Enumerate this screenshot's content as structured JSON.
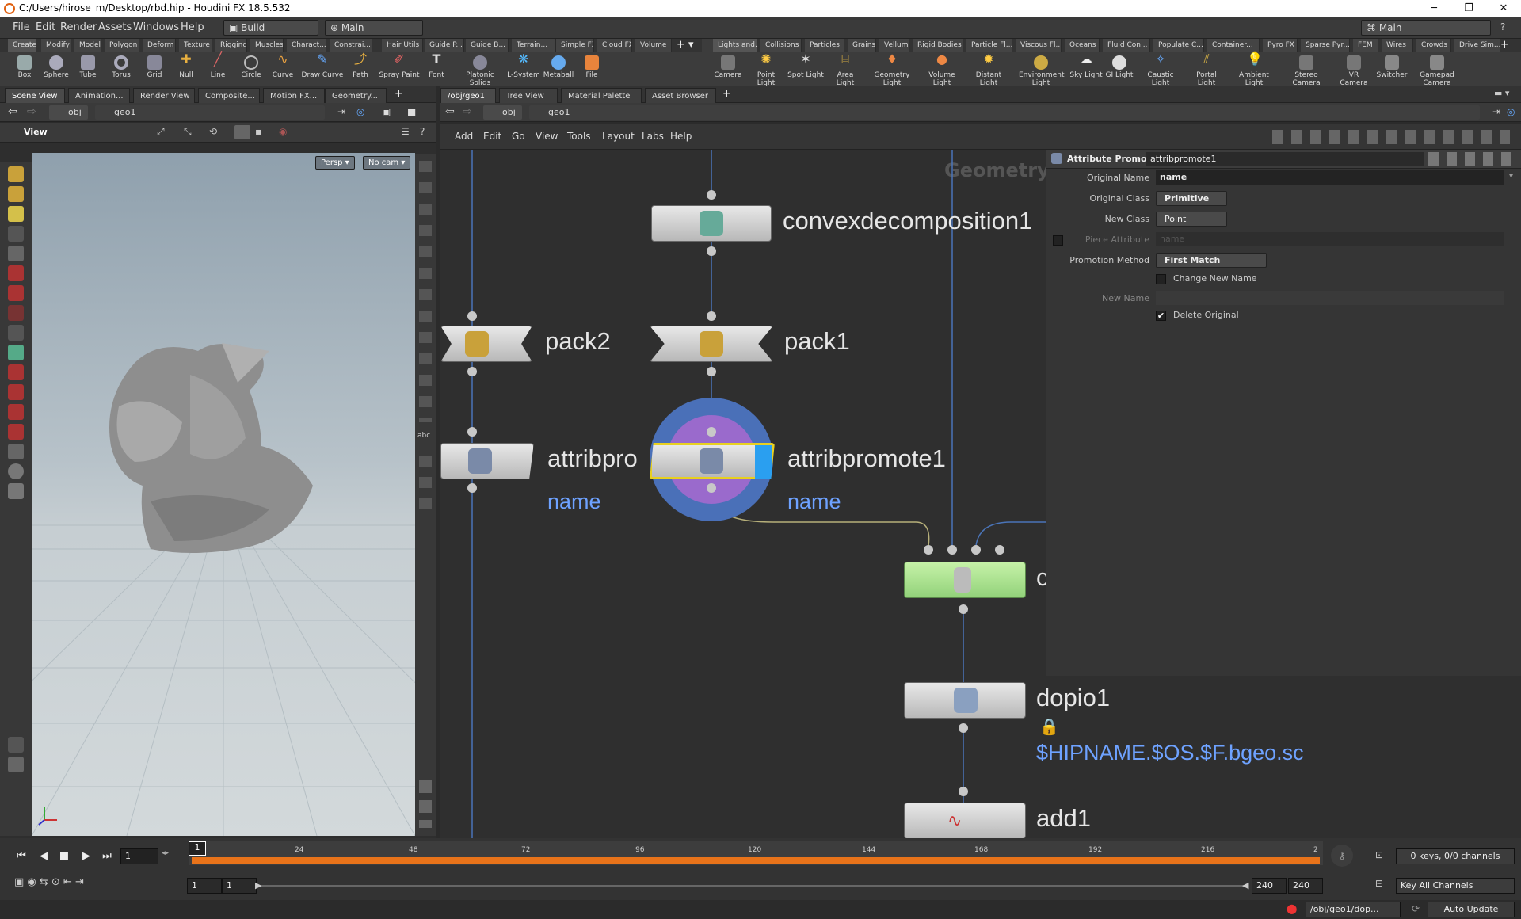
{
  "title_bar": {
    "text": "C:/Users/hirose_m/Desktop/rbd.hip - Houdini FX 18.5.532",
    "minimize": "─",
    "maximize": "❐",
    "close": "✕"
  },
  "menu": {
    "items": [
      "File",
      "Edit",
      "Render",
      "Assets",
      "Windows",
      "Help"
    ],
    "desktop": "Build",
    "workspace": "Main",
    "right_desktop": "Main"
  },
  "shelf_left": {
    "tabs": [
      "Create",
      "Modify",
      "Model",
      "Polygon",
      "Deform",
      "Texture",
      "Rigging",
      "Muscles",
      "Charact...",
      "Constrai...",
      "Hair Utils",
      "Guide P...",
      "Guide B...",
      "Terrain...",
      "Simple FX",
      "Cloud FX",
      "Volume"
    ],
    "tools": [
      "Box",
      "Sphere",
      "Tube",
      "Torus",
      "Grid",
      "Null",
      "Line",
      "Circle",
      "Curve",
      "Draw Curve",
      "Path",
      "Spray Paint",
      "Font",
      "Platonic Solids",
      "L-System",
      "Metaball",
      "File"
    ]
  },
  "shelf_right": {
    "tabs": [
      "Lights and...",
      "Collisions",
      "Particles",
      "Grains",
      "Vellum",
      "Rigid Bodies",
      "Particle Fl...",
      "Viscous Fl...",
      "Oceans",
      "Fluid Con...",
      "Populate C...",
      "Container...",
      "Pyro FX",
      "Sparse Pyr...",
      "FEM",
      "Wires",
      "Crowds",
      "Drive Sim..."
    ],
    "tools": [
      "Camera",
      "Point Light",
      "Spot Light",
      "Area Light",
      "Geometry Light",
      "Volume Light",
      "Distant Light",
      "Environment Light",
      "Sky Light",
      "GI Light",
      "Caustic Light",
      "Portal Light",
      "Ambient Light",
      "Stereo Camera",
      "VR Camera",
      "Switcher",
      "Gamepad Camera"
    ]
  },
  "left_pane": {
    "tabs": [
      "Scene View",
      "Animation...",
      "Render View",
      "Composite...",
      "Motion FX...",
      "Geometry..."
    ],
    "path": [
      "obj",
      "geo1"
    ],
    "view_label": "View",
    "persp": "Persp ▾",
    "cam": "No cam ▾",
    "abc": "abc"
  },
  "right_pane": {
    "tabs": [
      "/obj/geo1",
      "Tree View",
      "Material Palette",
      "Asset Browser"
    ],
    "path": [
      "obj",
      "geo1"
    ],
    "net_menu": [
      "Add",
      "Edit",
      "Go",
      "View",
      "Tools",
      "Layout",
      "Labs",
      "Help"
    ],
    "watermark": "Geometry"
  },
  "nodes": {
    "convex": "convexdecomposition1",
    "pack2": "pack2",
    "pack1": "pack1",
    "ap_left": "attribpro",
    "ap_left_sub": "name",
    "ap1": "attribpromote1",
    "ap1_sub": "name",
    "merge_label": "c",
    "dopio": "dopio1",
    "dopio_sub": "$HIPNAME.$OS.$F.bgeo.sc",
    "add": "add1"
  },
  "params": {
    "node_type": "Attribute Promote",
    "node_name": "attribpromote1",
    "original_name_label": "Original Name",
    "original_name": "name",
    "original_class_label": "Original Class",
    "original_class": "Primitive",
    "new_class_label": "New Class",
    "new_class": "Point",
    "piece_attr_label": "Piece Attribute",
    "piece_attr": "name",
    "method_label": "Promotion Method",
    "method": "First Match",
    "change_name_label": "Change New Name",
    "new_name_label": "New Name",
    "delete_orig_label": "Delete Original",
    "delete_orig_checked": "✔"
  },
  "timeline": {
    "frame": "1",
    "ticks": [
      "1",
      "24",
      "48",
      "72",
      "96",
      "120",
      "144",
      "168",
      "192",
      "216",
      "2"
    ],
    "start": "1",
    "start2": "1",
    "end": "240",
    "end2": "240",
    "keys": "0 keys, 0/0 channels",
    "key_all": "Key All Channels",
    "status_path": "/obj/geo1/dop...",
    "auto_update": "Auto Update"
  }
}
